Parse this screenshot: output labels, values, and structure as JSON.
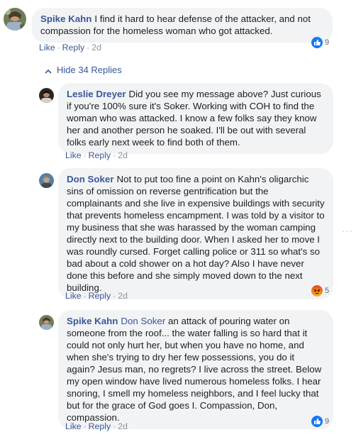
{
  "comments": [
    {
      "author": "Spike Kahn",
      "mention": "",
      "text": "I find it hard to hear defense of the attacker, and not compassion for the homeless woman who got attacked.",
      "like": "Like",
      "reply": "Reply",
      "time": "2d",
      "reaction_count": "9",
      "reaction_icon": "like-icon"
    },
    {
      "author": "Leslie Dreyer",
      "mention": "",
      "text": "Did you see my message above? Just curious if you're 100% sure it's Soker. Working with COH to find the woman who was attacked. I know a few folks say they know her and another person he soaked. I'll be out with several folks early next week to find both of them.",
      "like": "Like",
      "reply": "Reply",
      "time": "2d"
    },
    {
      "author": "Don Soker",
      "mention": "",
      "text": "Not to put too fine a point on Kahn's oligarchic sins of omission on reverse gentrification but the complainants and she live in expensive buildings with security that prevents homeless encampment. I was told by a visitor to my business that she was harassed by the woman camping directly next to the building door. When I asked her to move I was roundly cursed. Forget calling police or 311 so what's so bad about a cold shower on a hot day? Also I have never done this before and she simply moved down to the next building.",
      "like": "Like",
      "reply": "Reply",
      "time": "2d",
      "reaction_count": "5",
      "reaction_icon": "angry-icon"
    },
    {
      "author": "Spike Kahn",
      "mention": "Don Soker",
      "text": "an attack of pouring water on someone from the roof... the water falling is so hard that it could not only hurt her, but when you have no home, and when she's trying to dry her few possessions, you do it again? Jesus man, no regrets? I live across the street. Below my open window have lived numerous homeless folks. I hear snoring, I smell my homeless neighbors, and I feel lucky that but for the grace of God goes I. Compassion, Don, compassion.",
      "like": "Like",
      "reply": "Reply",
      "time": "2d",
      "reaction_count": "9",
      "reaction_icon": "like-icon"
    }
  ],
  "hide_replies_label": "Hide 34 Replies",
  "more_dots": "···",
  "colors": {
    "link": "#385898",
    "bubble": "#f2f3f5",
    "like_blue": "#1877f2",
    "angry_orange": "#e9710f"
  }
}
